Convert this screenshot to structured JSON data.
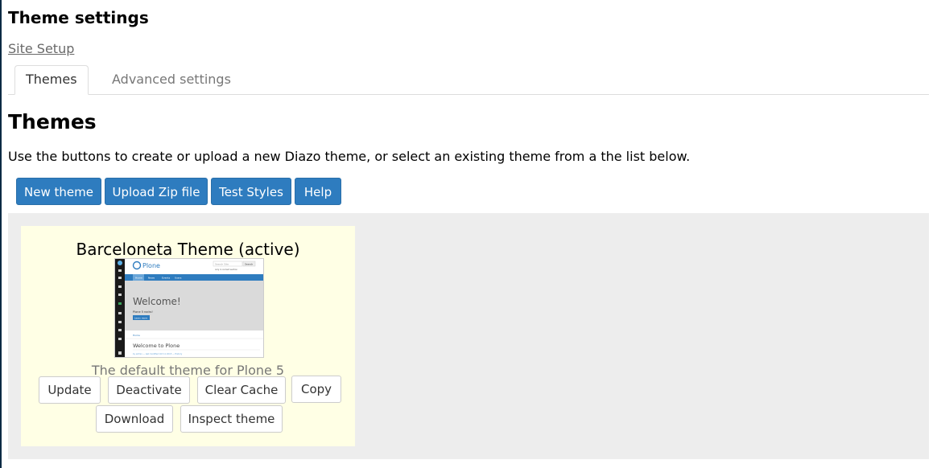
{
  "page": {
    "title": "Theme settings",
    "breadcrumb": "Site Setup"
  },
  "tabs": [
    {
      "label": "Themes",
      "active": true
    },
    {
      "label": "Advanced settings",
      "active": false
    }
  ],
  "main": {
    "heading": "Themes",
    "intro": "Use the buttons to create or upload a new Diazo theme, or select an existing theme from a the list below.",
    "buttons": {
      "new_theme": "New theme",
      "upload_zip": "Upload Zip file",
      "test_styles": "Test Styles",
      "help": "Help"
    }
  },
  "theme_card": {
    "title": "Barceloneta Theme (active)",
    "description": "The default theme for Plone 5",
    "buttons": {
      "update": "Update",
      "deactivate": "Deactivate",
      "clear_cache": "Clear Cache",
      "copy": "Copy",
      "download": "Download",
      "inspect": "Inspect theme"
    },
    "preview": {
      "logo": "Plone",
      "search_placeholder": "Search Site",
      "search_button": "Search",
      "search_option": "only in current section",
      "nav": [
        "Home",
        "News",
        "Events",
        "Users"
      ],
      "welcome": "Welcome!",
      "tagline": "Plone 5 rocks!",
      "learn_more": "Learn more",
      "crumb": "Home",
      "doc_title": "Welcome to Plone",
      "byline": "by admin — last modified Oct 11 2015 — History"
    }
  },
  "colors": {
    "primary": "#2e7cbf",
    "card_bg": "#ffffe5",
    "area_bg": "#ededed",
    "toolbar": "#1a1a1a"
  }
}
